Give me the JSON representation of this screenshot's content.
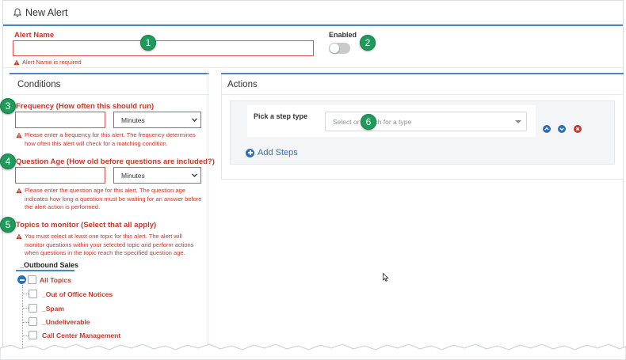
{
  "header": {
    "title": "New Alert",
    "icon": "bell-icon"
  },
  "alert_name": {
    "label": "Alert Name",
    "value": "",
    "error": "Alert Name is required"
  },
  "enabled": {
    "label": "Enabled",
    "on": false
  },
  "conditions": {
    "title": "Conditions",
    "frequency": {
      "label": "Frequency (How often this should run)",
      "value": "",
      "unit": "Minutes",
      "error": "Please enter a frequency for this alert. The frequency determines how often this alert will check for a matching condition."
    },
    "question_age": {
      "label": "Question Age (How old before questions are included?)",
      "value": "",
      "unit": "Minutes",
      "error": "Please enter the question age for this alert. The question age indicates how long a question must be waiting for an answer before the alert action is performed."
    },
    "topics": {
      "label": "Topics to monitor (Select that all apply)",
      "error": "You must select at least one topic for this alert. The alert will monitor questions within your selected topic and perform actions when questions in the topic reach the specified question age.",
      "tab": "_Outbound Sales",
      "root": "All Topics",
      "items": [
        "_Out of Office Notices",
        "_Spam",
        "_Undeliverable",
        "Call Center Management"
      ]
    }
  },
  "actions": {
    "title": "Actions",
    "step_label": "Pick a step type",
    "step_placeholder": "Select or search for a type",
    "add_steps": "Add Steps"
  },
  "callouts": [
    "1",
    "2",
    "3",
    "4",
    "5",
    "6"
  ],
  "colors": {
    "accent": "#4a86c5",
    "error": "#c0392b",
    "callout": "#1f9a5a",
    "link": "#2f6fb1"
  }
}
